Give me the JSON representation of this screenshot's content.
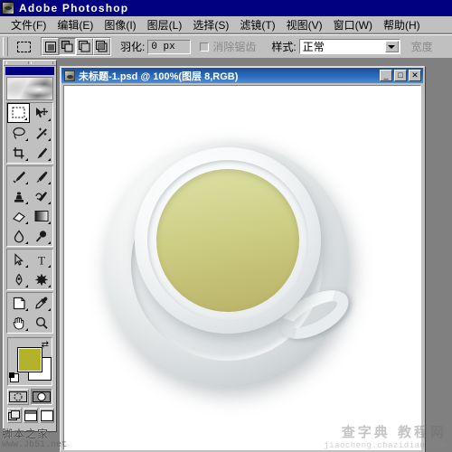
{
  "window": {
    "app_title": "Adobe Photoshop",
    "app_icon": "photoshop-app-icon"
  },
  "menubar": {
    "items": [
      {
        "label": "文件(F)",
        "name": "menu-file"
      },
      {
        "label": "编辑(E)",
        "name": "menu-edit"
      },
      {
        "label": "图像(I)",
        "name": "menu-image"
      },
      {
        "label": "图层(L)",
        "name": "menu-layer"
      },
      {
        "label": "选择(S)",
        "name": "menu-select"
      },
      {
        "label": "滤镜(T)",
        "name": "menu-filter"
      },
      {
        "label": "视图(V)",
        "name": "menu-view"
      },
      {
        "label": "窗口(W)",
        "name": "menu-window"
      },
      {
        "label": "帮助(H)",
        "name": "menu-help"
      }
    ]
  },
  "options_bar": {
    "active_tool_icon": "rectangular-marquee-icon",
    "selection_modes": [
      {
        "name": "new-selection",
        "icon": "square-filled-icon",
        "pressed": false
      },
      {
        "name": "add-to-selection",
        "icon": "two-squares-icon",
        "pressed": true
      },
      {
        "name": "subtract-from-selection",
        "icon": "square-minus-icon",
        "pressed": false
      },
      {
        "name": "intersect-selection",
        "icon": "square-intersect-icon",
        "pressed": false
      }
    ],
    "feather_label": "羽化:",
    "feather_value": "0 px",
    "feather_placeholder": "0 px",
    "antialias_label": "消除锯齿",
    "antialias_checked": false,
    "style_label": "样式:",
    "style_value": "正常",
    "style_options": [
      "正常"
    ],
    "width_label": "宽度",
    "width_disabled": true
  },
  "toolbox": {
    "foreground_color": "#b3b32b",
    "background_color": "#ffffff",
    "swap_icon": "swap-colors-icon",
    "default_colors_icon": "default-colors-icon",
    "tools": [
      {
        "name": "tool-rectangular-marquee",
        "glyph": "marquee",
        "selected": true
      },
      {
        "name": "tool-move",
        "glyph": "move",
        "selected": false
      },
      {
        "name": "tool-lasso",
        "glyph": "lasso",
        "selected": false
      },
      {
        "name": "tool-magic-wand",
        "glyph": "wand",
        "selected": false
      },
      {
        "name": "tool-crop",
        "glyph": "crop",
        "selected": false
      },
      {
        "name": "tool-slice",
        "glyph": "slice",
        "selected": false
      },
      {
        "name": "tool-healing-brush",
        "glyph": "heal",
        "selected": false
      },
      {
        "name": "tool-paintbrush",
        "glyph": "brush",
        "selected": false
      },
      {
        "name": "tool-clone-stamp",
        "glyph": "stamp",
        "selected": false
      },
      {
        "name": "tool-history-brush",
        "glyph": "historybrush",
        "selected": false
      },
      {
        "name": "tool-eraser",
        "glyph": "eraser",
        "selected": false
      },
      {
        "name": "tool-gradient",
        "glyph": "gradient",
        "selected": false
      },
      {
        "name": "tool-blur",
        "glyph": "blur",
        "selected": false
      },
      {
        "name": "tool-dodge",
        "glyph": "dodge",
        "selected": false
      },
      {
        "name": "tool-path-selection",
        "glyph": "pathselect",
        "selected": false
      },
      {
        "name": "tool-type",
        "glyph": "type",
        "selected": false
      },
      {
        "name": "tool-pen",
        "glyph": "pen",
        "selected": false
      },
      {
        "name": "tool-custom-shape",
        "glyph": "shape",
        "selected": false
      },
      {
        "name": "tool-notes",
        "glyph": "notes",
        "selected": false
      },
      {
        "name": "tool-eyedropper",
        "glyph": "eyedropper",
        "selected": false
      },
      {
        "name": "tool-hand",
        "glyph": "hand",
        "selected": false
      },
      {
        "name": "tool-zoom",
        "glyph": "zoom",
        "selected": false
      }
    ],
    "mask_modes": [
      {
        "name": "standard-mode-button",
        "icon": "standard-mask-icon",
        "active": false
      },
      {
        "name": "quick-mask-mode-button",
        "icon": "quick-mask-icon",
        "active": true
      }
    ],
    "screen_modes": [
      {
        "name": "standard-screen-mode-button",
        "icon": "standard-screen-icon"
      },
      {
        "name": "full-screen-with-menubar-button",
        "icon": "fullscreen-menubar-icon"
      },
      {
        "name": "full-screen-mode-button",
        "icon": "fullscreen-icon"
      }
    ]
  },
  "document": {
    "title": "未标题-1.psd @ 100%(图层 8,RGB)",
    "icon": "document-icon",
    "minimize_label": "_",
    "maximize_label": "□",
    "close_label": "✕",
    "artwork": {
      "name": "teacup-with-green-tea-top-view",
      "saucer_color": "#e4e7e8",
      "cup_color": "#f2f4f5",
      "tea_color_top": "#dde0a5",
      "tea_color_bottom": "#b9b266",
      "background_color": "#ffffff"
    }
  },
  "watermarks": {
    "left_cn": "脚本之家",
    "left_en": "www.Jb51.net",
    "right_cn": "查字典 教程网",
    "right_en": "jiaocheng.chazidian.com"
  }
}
